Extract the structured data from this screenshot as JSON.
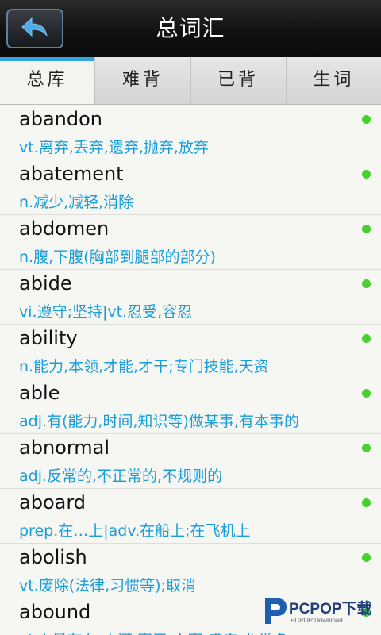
{
  "header": {
    "title": "总词汇",
    "back_icon": "back-arrow-icon"
  },
  "tabs": [
    {
      "label": "总库",
      "active": true
    },
    {
      "label": "难背",
      "active": false
    },
    {
      "label": "已背",
      "active": false
    },
    {
      "label": "生词",
      "active": false
    }
  ],
  "words": [
    {
      "word": "abandon",
      "definition": "vt.离弃,丢弃,遗弃,抛弃,放弃"
    },
    {
      "word": "abatement",
      "definition": "n.减少,减轻,消除"
    },
    {
      "word": "abdomen",
      "definition": "n.腹,下腹(胸部到腿部的部分)"
    },
    {
      "word": "abide",
      "definition": "vi.遵守;坚持|vt.忍受,容忍"
    },
    {
      "word": "ability",
      "definition": "n.能力,本领,才能,才干;专门技能,天资"
    },
    {
      "word": "able",
      "definition": "adj.有(能力,时间,知识等)做某事,有本事的"
    },
    {
      "word": "abnormal",
      "definition": "adj.反常的,不正常的,不规则的"
    },
    {
      "word": "aboard",
      "definition": "prep.在…上|adv.在船上;在飞机上"
    },
    {
      "word": "abolish",
      "definition": "vt.废除(法律,习惯等);取消"
    },
    {
      "word": "abound",
      "definition": "vi.大量存在;充满,富于;大富,盛产;非常多"
    }
  ],
  "colors": {
    "accent": "#2fa6e1",
    "definition": "#1a9ed8",
    "status_dot": "#46d12e"
  },
  "watermark": {
    "text": "PCPOP下载",
    "subtext": "PCPOP Download"
  }
}
